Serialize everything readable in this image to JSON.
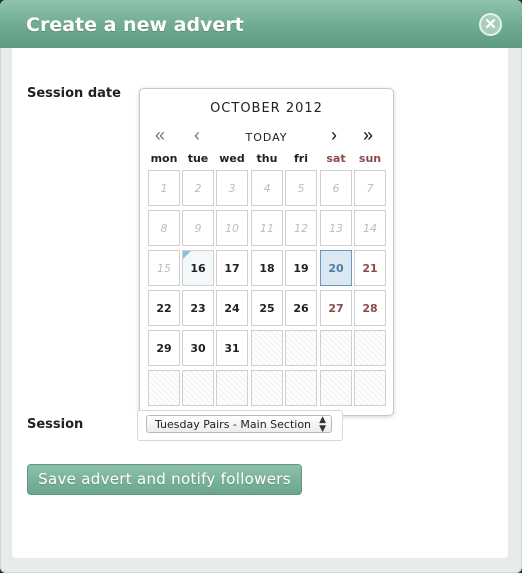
{
  "dialog": {
    "title": "Create a new advert",
    "close_symbol": "✕"
  },
  "form": {
    "session_date_label": "Session date",
    "session_label": "Session",
    "session_selected": "Tuesday Pairs - Main Section",
    "save_button": "Save advert and notify followers"
  },
  "calendar": {
    "month_label": "OCTOBER 2012",
    "today_label": "TODAY",
    "nav": {
      "prev_year": "«",
      "prev_month": "‹",
      "next_month": "›",
      "next_year": "»"
    },
    "weekdays": [
      "mon",
      "tue",
      "wed",
      "thu",
      "fri",
      "sat",
      "sun"
    ],
    "weeks": [
      [
        "1",
        "2",
        "3",
        "4",
        "5",
        "6",
        "7"
      ],
      [
        "8",
        "9",
        "10",
        "11",
        "12",
        "13",
        "14"
      ],
      [
        "15",
        "16",
        "17",
        "18",
        "19",
        "20",
        "21"
      ],
      [
        "22",
        "23",
        "24",
        "25",
        "26",
        "27",
        "28"
      ],
      [
        "29",
        "30",
        "31",
        "",
        "",
        "",
        ""
      ],
      [
        "",
        "",
        "",
        "",
        "",
        "",
        ""
      ]
    ],
    "past_days": [
      "1",
      "2",
      "3",
      "4",
      "5",
      "6",
      "7",
      "8",
      "9",
      "10",
      "11",
      "12",
      "13",
      "14",
      "15"
    ],
    "today_day": "16",
    "selected_day": "20"
  },
  "colors": {
    "accent": "#6da890",
    "weekend": "#8b4a4a",
    "selected": "#557c9c"
  }
}
